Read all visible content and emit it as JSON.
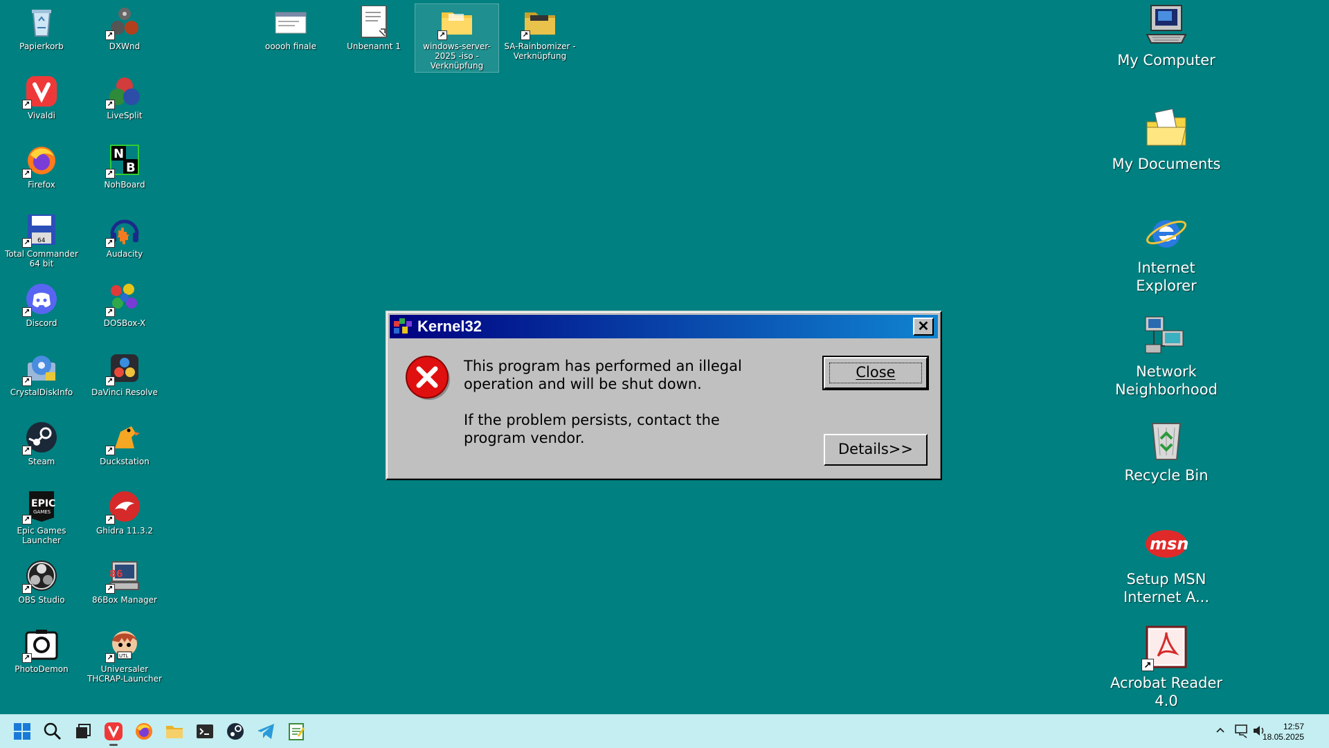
{
  "desktop_left": [
    {
      "label": "Papierkorb",
      "icon": "recycle-bin-icon"
    },
    {
      "label": "DXWnd",
      "icon": "dxwnd-icon"
    },
    {
      "label": "Vivaldi",
      "icon": "vivaldi-icon"
    },
    {
      "label": "LiveSplit",
      "icon": "livesplit-icon"
    },
    {
      "label": "Firefox",
      "icon": "firefox-icon"
    },
    {
      "label": "NohBoard",
      "icon": "nohboard-icon"
    },
    {
      "label": "Total Commander 64 bit",
      "icon": "total-commander-icon"
    },
    {
      "label": "Audacity",
      "icon": "audacity-icon"
    },
    {
      "label": "Discord",
      "icon": "discord-icon"
    },
    {
      "label": "DOSBox-X",
      "icon": "dosbox-icon"
    },
    {
      "label": "CrystalDiskInfo",
      "icon": "crystaldiskinfo-icon"
    },
    {
      "label": "DaVinci Resolve",
      "icon": "davinci-icon"
    },
    {
      "label": "Steam",
      "icon": "steam-icon"
    },
    {
      "label": "Duckstation",
      "icon": "duckstation-icon"
    },
    {
      "label": "Epic Games Launcher",
      "icon": "epic-games-icon"
    },
    {
      "label": "Ghidra 11.3.2",
      "icon": "ghidra-icon"
    },
    {
      "label": "OBS Studio",
      "icon": "obs-icon"
    },
    {
      "label": "86Box Manager",
      "icon": "86box-icon"
    },
    {
      "label": "PhotoDemon",
      "icon": "photodemon-icon"
    },
    {
      "label": "Universaler THCRAP-Launcher",
      "icon": "thcrap-icon"
    }
  ],
  "desktop_top": [
    {
      "label": "ooooh finale",
      "icon": "window-file-icon"
    },
    {
      "label": "Unbenannt 1",
      "icon": "document-icon"
    },
    {
      "label": "windows-server-2025 -iso - Verknüpfung",
      "icon": "folder-shortcut-icon"
    },
    {
      "label": "SA-Rainbomizer - Verknüpfung",
      "icon": "folder-shortcut-icon"
    }
  ],
  "desktop_right": [
    {
      "label": "My Computer",
      "icon": "my-computer-icon"
    },
    {
      "label": "My Documents",
      "icon": "my-documents-icon"
    },
    {
      "label": "Internet Explorer",
      "icon": "internet-explorer-icon"
    },
    {
      "label": "Network Neighborhood",
      "icon": "network-neighborhood-icon"
    },
    {
      "label": "Recycle Bin",
      "icon": "recycle-bin-icon"
    },
    {
      "label": "Setup MSN Internet A...",
      "icon": "msn-icon"
    },
    {
      "label": "Acrobat Reader 4.0",
      "icon": "acrobat-icon"
    }
  ],
  "dialog": {
    "title": "Kernel32",
    "message1": "This program has performed an illegal operation and will be shut down.",
    "message2": "If the problem persists, contact the program vendor.",
    "close_label": "Close",
    "details_label": "Details>>",
    "close_x": "✕"
  },
  "taskbar": {
    "items": [
      "start-icon",
      "search-icon",
      "task-view-icon",
      "vivaldi-icon",
      "firefox-icon",
      "file-explorer-icon",
      "terminal-icon",
      "steam-icon",
      "telegram-icon",
      "notepad-icon"
    ],
    "time": "12:57",
    "date": "18.05.2025"
  },
  "colors": {
    "desktop": "#008080",
    "title_start": "#000080",
    "title_end": "#1084d0",
    "taskbar": "#c4eef1"
  }
}
